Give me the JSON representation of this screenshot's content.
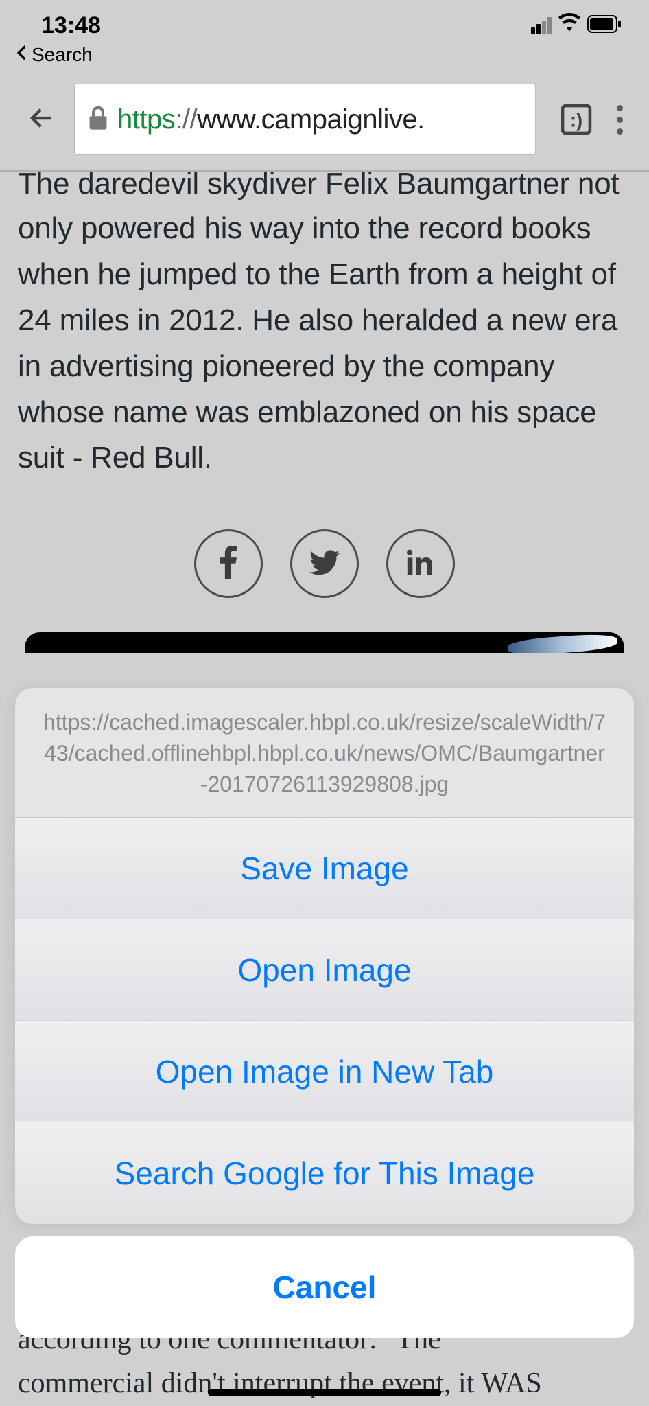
{
  "status_bar": {
    "time": "13:48"
  },
  "back_app": {
    "label": "Search"
  },
  "browser": {
    "url_protocol": "https",
    "url_sep": "://",
    "url_host": "www.campaignlive."
  },
  "article": {
    "paragraph_cut": "The daredevil skydiver Felix Baumgartner not",
    "paragraph_rest": "only powered his way into the record books when he jumped to the Earth from a height of 24 miles in 2012. He also heralded a new era in advertising pioneered by the company whose name was emblazoned on his space suit - Red Bull.",
    "bottom_text_1": "according to one commentator: \"The",
    "bottom_text_2": "commercial didn't interrupt the event, it WAS"
  },
  "action_sheet": {
    "image_url": "https://cached.imagescaler.hbpl.co.uk/resize/scaleWidth/743/cached.offlinehbpl.hbpl.co.uk/news/OMC/Baumgartner-20170726113929808.jpg",
    "buttons": [
      "Save Image",
      "Open Image",
      "Open Image in New Tab",
      "Search Google for This Image"
    ],
    "cancel": "Cancel"
  }
}
